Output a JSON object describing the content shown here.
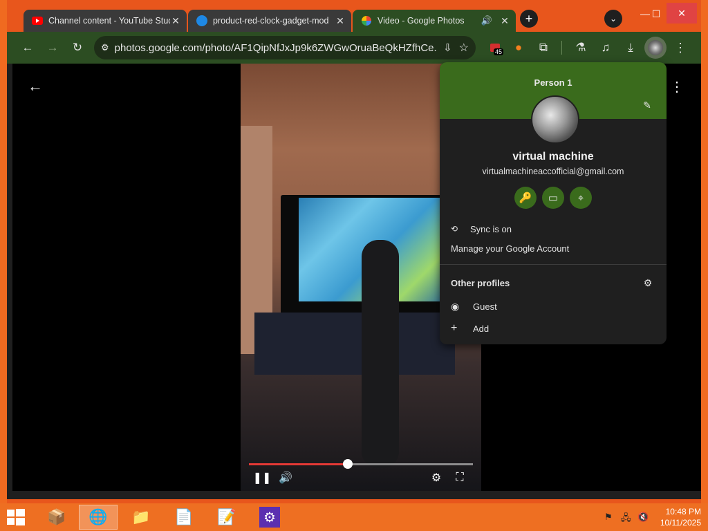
{
  "tabs": [
    {
      "title": "Channel content - YouTube Stud",
      "close": "✕"
    },
    {
      "title": "product-red-clock-gadget-mod",
      "close": "✕"
    },
    {
      "title": "Video - Google Photos",
      "close": "✕"
    }
  ],
  "new_tab_label": "+",
  "window_controls": {
    "minimize": "—",
    "maximize": "☐",
    "close": "✕"
  },
  "address_bar": {
    "url": "photos.google.com/photo/AF1QipNfJxJp9k6ZWGwOruaBeQkHZfhCe..."
  },
  "extension_badge": "45",
  "profile_menu": {
    "header_title": "Person 1",
    "name": "virtual machine",
    "email": "virtualmachineaccofficial@gmail.com",
    "sync_label": "Sync is on",
    "manage_label": "Manage your Google Account",
    "other_profiles_label": "Other profiles",
    "guest_label": "Guest",
    "add_label": "Add"
  },
  "video_player": {
    "progress": 0.44
  },
  "colors": {
    "accent_green": "#3a6b1c",
    "progress_red": "#e53935",
    "desktop_orange": "#e8561c"
  },
  "taskbar": {
    "apps": [
      "winrar-icon",
      "browser-icon",
      "file-explorer-icon",
      "notepad-icon",
      "editor-icon",
      "settings-icon"
    ],
    "time": "10:48 PM",
    "date": "10/11/2025"
  }
}
